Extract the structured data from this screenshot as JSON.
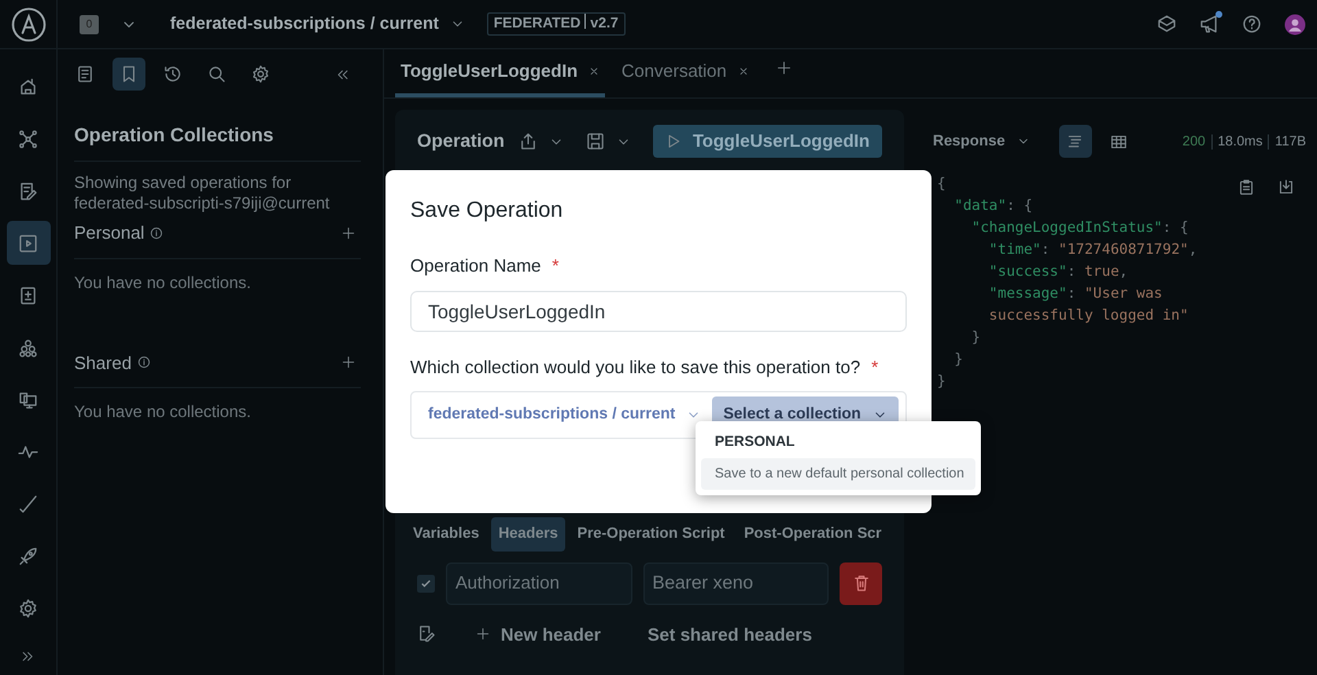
{
  "top_bar": {
    "graph_badge": "0",
    "graph_title": "federated-subscriptions / current",
    "federation_badge": "FEDERATED",
    "version": "v2.7",
    "notification_unread": true
  },
  "nav_rail": [
    {
      "kind": "home",
      "selected": false
    },
    {
      "kind": "graph",
      "selected": false
    },
    {
      "kind": "schema",
      "selected": false
    },
    {
      "kind": "explorer",
      "selected": true
    },
    {
      "kind": "changelog",
      "selected": false
    },
    {
      "kind": "subgraphs",
      "selected": false
    },
    {
      "kind": "clients",
      "selected": false
    },
    {
      "kind": "insights",
      "selected": false
    },
    {
      "kind": "checks",
      "selected": false
    },
    {
      "kind": "launches",
      "selected": false
    },
    {
      "kind": "settings",
      "selected": false
    }
  ],
  "sidebar": {
    "toolbar": [
      {
        "kind": "docs",
        "selected": false
      },
      {
        "kind": "bookmark",
        "selected": true
      },
      {
        "kind": "history",
        "selected": false
      },
      {
        "kind": "search",
        "selected": false
      },
      {
        "kind": "settings",
        "selected": false
      }
    ],
    "title": "Operation Collections",
    "description": "Showing saved operations for federated-subscripti-s79iji@current",
    "sections": [
      {
        "title": "Personal",
        "empty_text": "You have no collections."
      },
      {
        "title": "Shared",
        "empty_text": "You have no collections."
      }
    ]
  },
  "tabs": [
    {
      "label": "ToggleUserLoggedIn",
      "selected": true
    },
    {
      "label": "Conversation",
      "selected": false
    }
  ],
  "operation": {
    "title": "Operation",
    "run_label": "ToggleUserLoggedIn",
    "sub_tabs": [
      {
        "label": "Variables",
        "selected": false
      },
      {
        "label": "Headers",
        "selected": true
      },
      {
        "label": "Pre-Operation Script",
        "selected": false
      },
      {
        "label": "Post-Operation Scr",
        "selected": false
      }
    ],
    "headers": [
      {
        "checked": true,
        "key": "Authorization",
        "value": "Bearer xeno"
      }
    ],
    "new_header": "New header",
    "shared_headers": "Set shared headers"
  },
  "response": {
    "title": "Response",
    "views": [
      {
        "kind": "tree",
        "selected": true
      },
      {
        "kind": "table",
        "selected": false
      }
    ],
    "status": "200",
    "time": "18.0ms",
    "size": "117B",
    "body_lines": [
      [
        {
          "kind": "punct",
          "text": "{"
        }
      ],
      [
        {
          "kind": "key",
          "text": "  \"data\""
        },
        {
          "kind": "punct",
          "text": ": {"
        }
      ],
      [
        {
          "kind": "key",
          "text": "    \"changeLoggedInStatus\""
        },
        {
          "kind": "punct",
          "text": ": {"
        }
      ],
      [
        {
          "kind": "key",
          "text": "      \"time\""
        },
        {
          "kind": "punct",
          "text": ": "
        },
        {
          "kind": "string",
          "text": "\"1727460871792\""
        },
        {
          "kind": "punct",
          "text": ","
        }
      ],
      [
        {
          "kind": "key",
          "text": "      \"success\""
        },
        {
          "kind": "punct",
          "text": ": "
        },
        {
          "kind": "string",
          "text": "true"
        },
        {
          "kind": "punct",
          "text": ","
        }
      ],
      [
        {
          "kind": "key",
          "text": "      \"message\""
        },
        {
          "kind": "punct",
          "text": ": "
        },
        {
          "kind": "string",
          "text": "\"User was"
        }
      ],
      [
        {
          "kind": "string",
          "text": "      successfully logged in\""
        }
      ],
      [
        {
          "kind": "punct",
          "text": "    }"
        }
      ],
      [
        {
          "kind": "punct",
          "text": "  }"
        }
      ],
      [
        {
          "kind": "punct",
          "text": "}"
        }
      ]
    ]
  },
  "dialog": {
    "title": "Save Operation",
    "name_label": "Operation Name",
    "name_required": "*",
    "name_value": "ToggleUserLoggedIn",
    "collection_label": "Which collection would you like to save this operation to?",
    "collection_required": "*",
    "graph_select": "federated-subscriptions / current",
    "collection_select": "Select a collection",
    "menu": {
      "group": "PERSONAL",
      "items": [
        {
          "label": "Save to a new default personal collection",
          "selected": true
        }
      ]
    }
  }
}
